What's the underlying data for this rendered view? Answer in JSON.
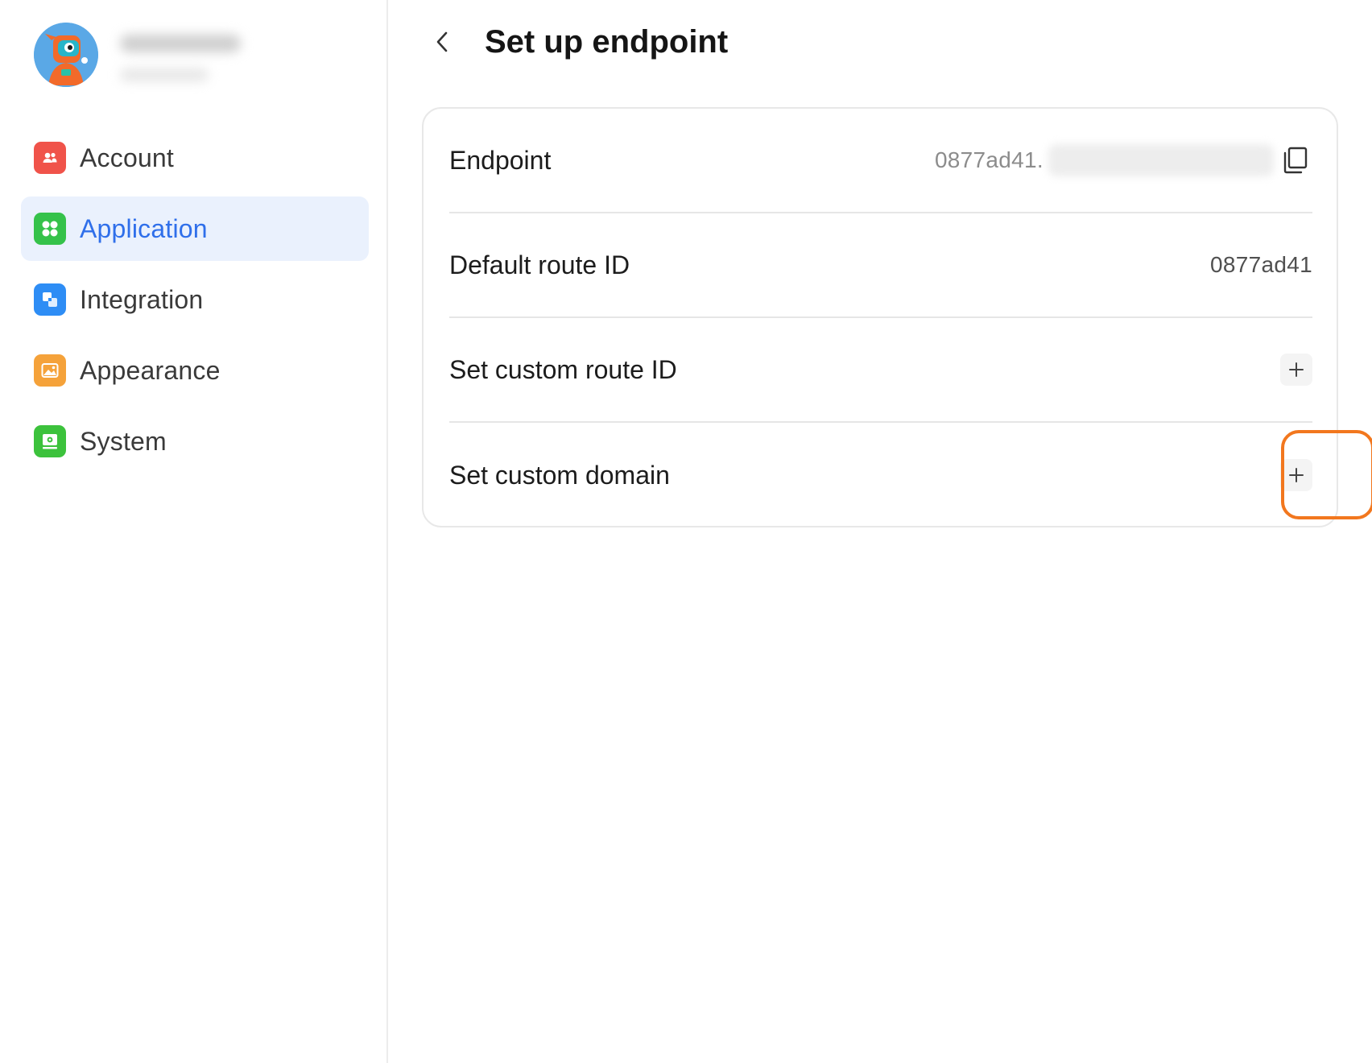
{
  "sidebar": {
    "items": [
      {
        "label": "Account",
        "icon": "account-icon",
        "color": "#f0534a",
        "active": false
      },
      {
        "label": "Application",
        "icon": "application-icon",
        "color": "#35c24a",
        "active": true
      },
      {
        "label": "Integration",
        "icon": "integration-icon",
        "color": "#2e8df5",
        "active": false
      },
      {
        "label": "Appearance",
        "icon": "appearance-icon",
        "color": "#f5a23a",
        "active": false
      },
      {
        "label": "System",
        "icon": "system-icon",
        "color": "#3cc23c",
        "active": false
      }
    ]
  },
  "header": {
    "title": "Set up endpoint"
  },
  "card": {
    "endpoint": {
      "label": "Endpoint",
      "value": "0877ad41."
    },
    "default_route": {
      "label": "Default route ID",
      "value": "0877ad41"
    },
    "custom_route": {
      "label": "Set custom route ID"
    },
    "custom_domain": {
      "label": "Set custom domain"
    }
  },
  "colors": {
    "accent": "#2f6fea",
    "active_bg": "#eaf1fd",
    "highlight": "#f2771e"
  }
}
